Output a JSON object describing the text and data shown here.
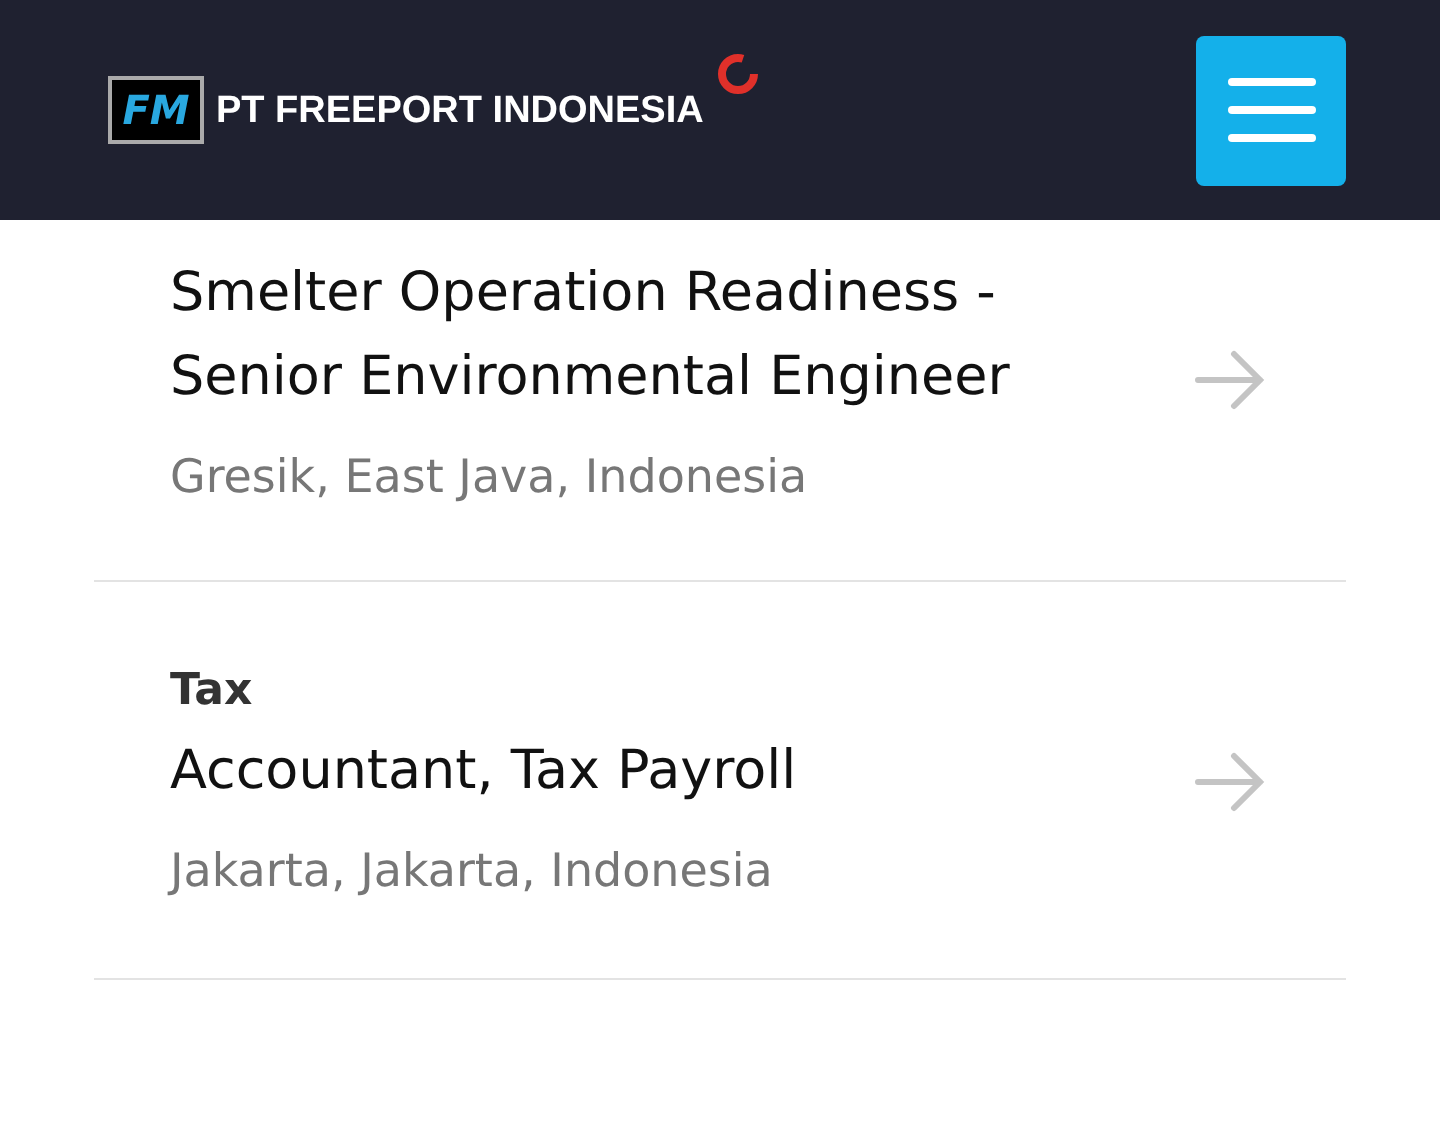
{
  "header": {
    "logo_mark": "FM",
    "logo_text": "PT FREEPORT INDONESIA"
  },
  "jobs": [
    {
      "title": "Smelter Operation Readiness - Senior Environmental Engineer",
      "location": "Gresik, East Java, Indonesia"
    },
    {
      "category": "Tax",
      "title": "Accountant, Tax Payroll",
      "location": "Jakarta, Jakarta, Indonesia"
    }
  ]
}
